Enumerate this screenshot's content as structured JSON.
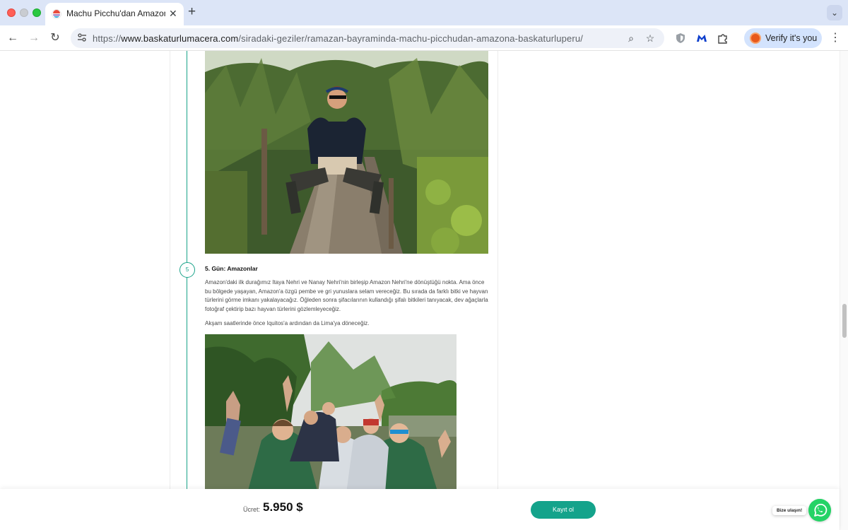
{
  "browser": {
    "tab": {
      "title": "Machu Picchu'dan Amazon'a Başka Turlu Peru",
      "close_glyph": "✕"
    },
    "new_tab_glyph": "+",
    "tab_search_glyph": "⌄",
    "nav": {
      "back_glyph": "←",
      "forward_glyph": "→",
      "reload_glyph": "↻"
    },
    "url": {
      "scheme": "https://",
      "host": "www.baskaturlumacera.com",
      "path": "/siradaki-geziler/ramazan-bayraminda-machu-picchudan-amazona-baskaturluperu/"
    },
    "zoom_glyph": "⌕",
    "bookmark_glyph": "☆",
    "verify_label": "Verify it's you",
    "menu_glyph": "⋮"
  },
  "content": {
    "day": {
      "number": "5",
      "title": "5. Gün: Amazonlar",
      "paragraphs": [
        "Amazon'daki ilk durağımız Itaya Nehri ve Nanay Nehri'nin birleşip Amazon Nehri'ne dönüştüğü nokta. Ama önce bu bölgede yaşayan, Amazon'a özgü pembe ve gri yunuslara selam vereceğiz. Bu sırada da farklı bitki ve hayvan türlerini görme imkanı yakalayacağız. Öğleden sonra şifacılarının kullandığı şifalı bitkileri tanıyacak, dev ağaçlarla fotoğraf çektirip bazı hayvan türlerini gözlemleyeceğiz.",
        "Akşam saatlerinde önce Iquitos'a ardından da Lima'ya döneceğiz."
      ]
    }
  },
  "footer": {
    "price_label": "Ücret:",
    "price_value": "5.950 $",
    "register_label": "Kayıt ol",
    "contact_label": "Bize ulaşın!"
  },
  "colors": {
    "accent": "#14a38b",
    "tabstrip": "#dce5f7",
    "whatsapp": "#25d366"
  }
}
